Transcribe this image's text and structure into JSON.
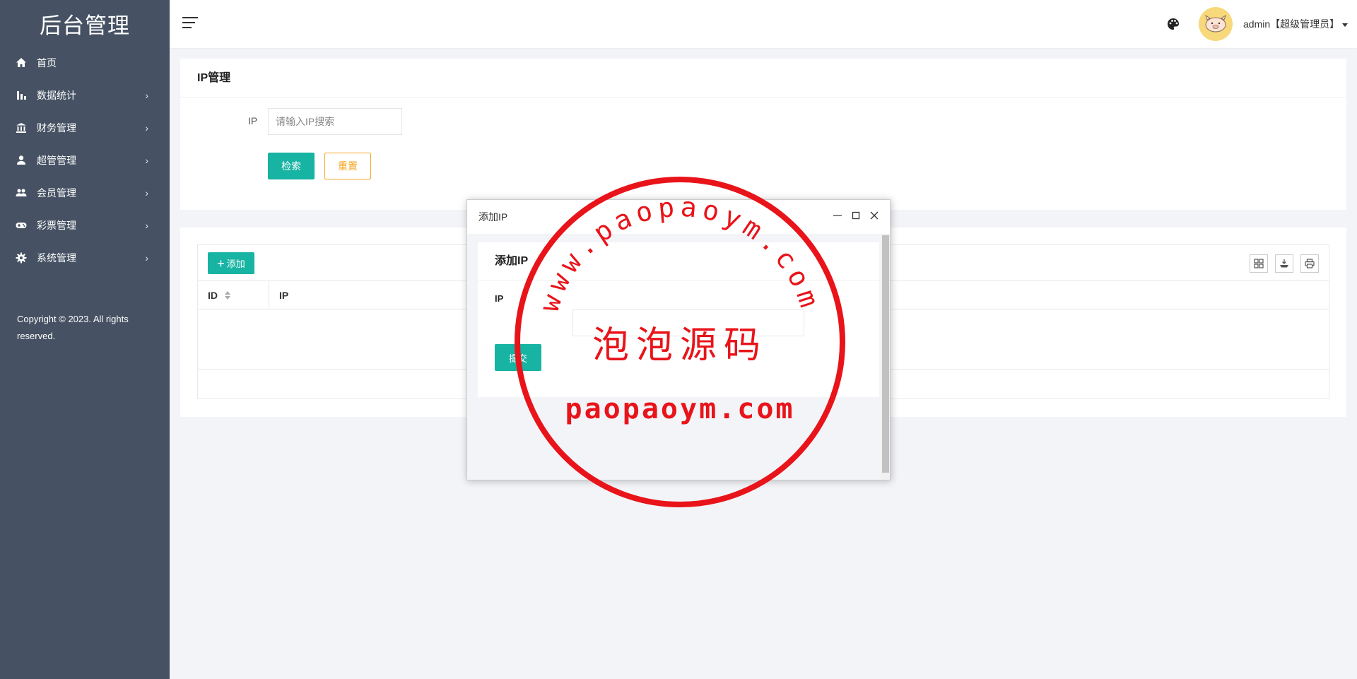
{
  "sidebar": {
    "brand": "后台管理",
    "items": [
      {
        "label": "首页",
        "icon": "home-icon",
        "has_children": false
      },
      {
        "label": "数据统计",
        "icon": "bar-chart-icon",
        "has_children": true
      },
      {
        "label": "财务管理",
        "icon": "bank-icon",
        "has_children": true
      },
      {
        "label": "超管管理",
        "icon": "person-icon",
        "has_children": true
      },
      {
        "label": "会员管理",
        "icon": "people-icon",
        "has_children": true
      },
      {
        "label": "彩票管理",
        "icon": "gamepad-icon",
        "has_children": true
      },
      {
        "label": "系统管理",
        "icon": "gear-icon",
        "has_children": true
      }
    ],
    "chevron": "›",
    "copyright": "Copyright © 2023. All rights reserved."
  },
  "topbar": {
    "user_label": "admin【超级管理员】"
  },
  "search_panel": {
    "title": "IP管理",
    "ip_label": "IP",
    "ip_placeholder": "请输入IP搜索",
    "ip_value": "",
    "search_button": "检索",
    "reset_button": "重置"
  },
  "table": {
    "add_button": "添加",
    "columns": [
      "ID",
      "IP"
    ],
    "rows": []
  },
  "modal": {
    "window_title": "添加IP",
    "form_title": "添加IP",
    "ip_label": "IP",
    "ip_value": "",
    "submit_button": "提交"
  },
  "watermark": {
    "arc_text": "www.paopaoym.com",
    "center_text": "泡泡源码",
    "bottom_text": "paopaoym.com"
  },
  "colors": {
    "sidebar_bg": "#465263",
    "primary": "#17b3a3",
    "warning": "#f5a623",
    "page_bg": "#f3f4f8",
    "stamp_red": "#e8141a"
  }
}
